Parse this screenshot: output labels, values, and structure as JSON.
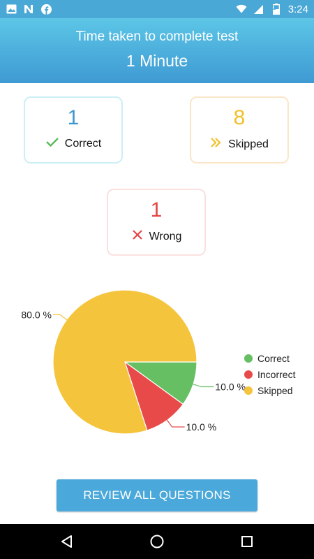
{
  "status_bar": {
    "time": "3:24",
    "battery": "2",
    "left_icons": [
      "image-icon",
      "n-icon",
      "facebook-icon"
    ],
    "right_icons": [
      "wifi-icon",
      "signal-icon",
      "battery-icon"
    ]
  },
  "header": {
    "title": "Time taken to complete test",
    "value": "1 Minute"
  },
  "stats": {
    "correct": {
      "count": "1",
      "label": "Correct",
      "icon": "check-icon",
      "color": "#3e97cf"
    },
    "skipped": {
      "count": "8",
      "label": "Skipped",
      "icon": "double-chevron-right-icon",
      "color": "#f1c12b"
    },
    "wrong": {
      "count": "1",
      "label": "Wrong",
      "icon": "cross-icon",
      "color": "#e34646"
    }
  },
  "chart_data": {
    "type": "pie",
    "slices": [
      {
        "name": "Correct",
        "value": 10.0,
        "label": "10.0 %",
        "color": "#66bf62"
      },
      {
        "name": "Incorrect",
        "value": 10.0,
        "label": "10.0 %",
        "color": "#e84a4a"
      },
      {
        "name": "Skipped",
        "value": 80.0,
        "label": "80.0 %",
        "color": "#f5c43d"
      }
    ],
    "legend": [
      "Correct",
      "Incorrect",
      "Skipped"
    ],
    "legend_position": "right"
  },
  "actions": {
    "review_label": "REVIEW ALL QUESTIONS"
  },
  "nav_bar": {
    "icons": [
      "back-icon",
      "home-icon",
      "recents-icon"
    ]
  }
}
